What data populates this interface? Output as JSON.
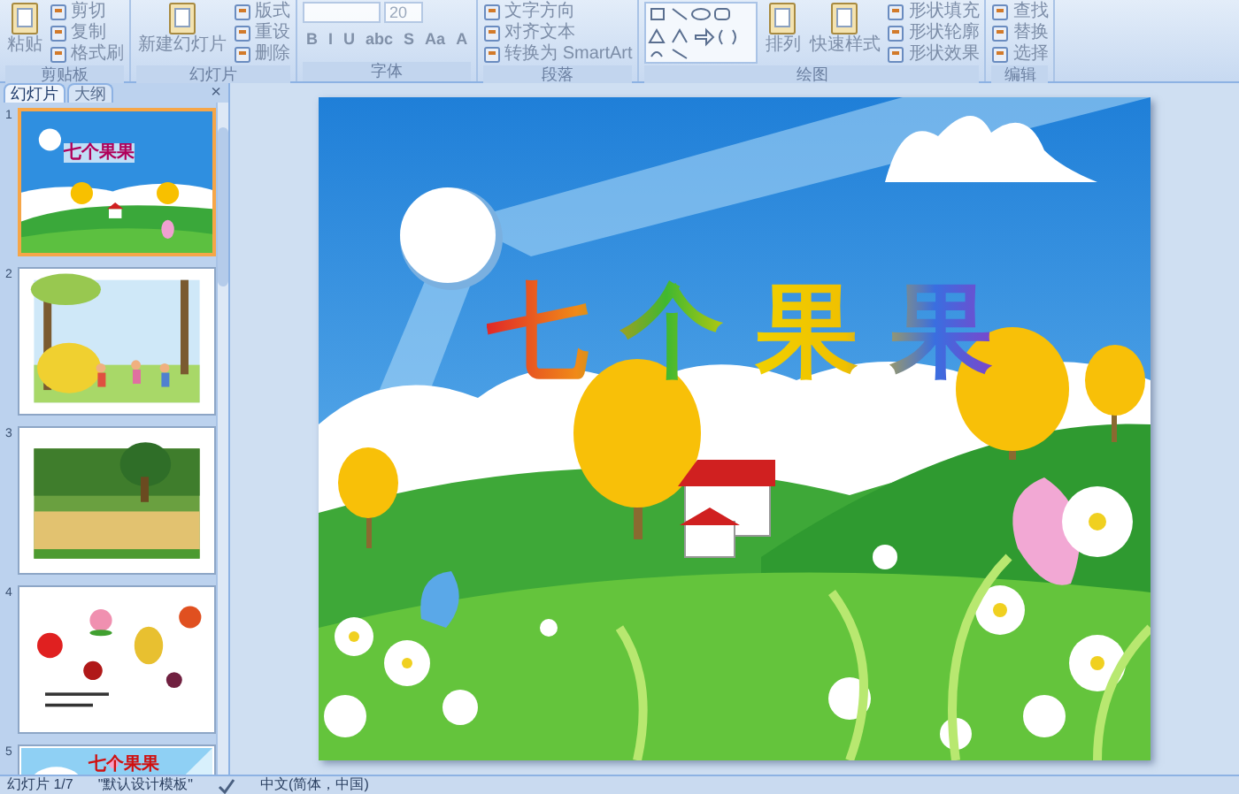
{
  "ribbon": {
    "groups": [
      {
        "label": "剪贴板",
        "items": [
          {
            "kind": "large",
            "label": "粘贴"
          },
          {
            "kind": "small",
            "label": "剪切"
          },
          {
            "kind": "small",
            "label": "复制"
          },
          {
            "kind": "small",
            "label": "格式刷"
          }
        ]
      },
      {
        "label": "幻灯片",
        "items": [
          {
            "kind": "large",
            "label": "新建幻灯片"
          },
          {
            "kind": "small",
            "label": "版式"
          },
          {
            "kind": "small",
            "label": "重设"
          },
          {
            "kind": "small",
            "label": "删除"
          }
        ]
      },
      {
        "label": "字体",
        "items": [
          {
            "kind": "field",
            "label": "20"
          },
          {
            "kind": "glyph",
            "label": "B"
          },
          {
            "kind": "glyph",
            "label": "I"
          },
          {
            "kind": "glyph",
            "label": "U"
          },
          {
            "kind": "glyph",
            "label": "abc"
          },
          {
            "kind": "glyph",
            "label": "S"
          },
          {
            "kind": "glyph",
            "label": "Aa"
          },
          {
            "kind": "glyph",
            "label": "A"
          }
        ]
      },
      {
        "label": "段落",
        "items": [
          {
            "kind": "small",
            "label": "文字方向"
          },
          {
            "kind": "small",
            "label": "对齐文本"
          },
          {
            "kind": "small",
            "label": "转换为 SmartArt"
          }
        ]
      },
      {
        "label": "绘图",
        "items": [
          {
            "kind": "shapes"
          },
          {
            "kind": "large",
            "label": "排列"
          },
          {
            "kind": "large",
            "label": "快速样式"
          },
          {
            "kind": "small",
            "label": "形状填充"
          },
          {
            "kind": "small",
            "label": "形状轮廓"
          },
          {
            "kind": "small",
            "label": "形状效果"
          }
        ]
      },
      {
        "label": "编辑",
        "items": [
          {
            "kind": "small",
            "label": "查找"
          },
          {
            "kind": "small",
            "label": "替换"
          },
          {
            "kind": "small",
            "label": "选择"
          }
        ]
      }
    ]
  },
  "slide_panel": {
    "tabs": [
      {
        "label": "幻灯片",
        "selected": true
      },
      {
        "label": "大纲",
        "selected": false
      }
    ],
    "close": "×",
    "slides": [
      {
        "number": "1",
        "selected": true,
        "kind": "title",
        "title": "七个果果"
      },
      {
        "number": "2",
        "selected": false,
        "kind": "park"
      },
      {
        "number": "3",
        "selected": false,
        "kind": "orchard"
      },
      {
        "number": "4",
        "selected": false,
        "kind": "fruits"
      },
      {
        "number": "5",
        "selected": false,
        "kind": "sky",
        "title": "七个果果"
      }
    ]
  },
  "slide": {
    "title": "七个果果"
  },
  "status_bar": {
    "slide": "幻灯片 1/7",
    "theme": "\"默认设计模板\"",
    "language": "中文(简体，中国)"
  }
}
